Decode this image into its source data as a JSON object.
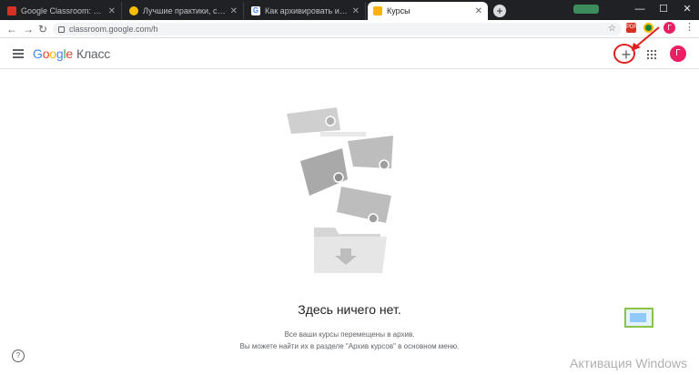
{
  "browser": {
    "tabs": [
      {
        "title": "Google Classroom: функционал",
        "favicon_color": "#d93025",
        "active": false
      },
      {
        "title": "Лучшие практики, советы и ин",
        "favicon_color": "#fbbc04",
        "active": false
      },
      {
        "title": "Как архивировать и удалять кур",
        "favicon_color": "#ffffff",
        "active": false
      },
      {
        "title": "Курсы",
        "favicon_color": "#f4b400",
        "active": true
      }
    ],
    "new_tab_symbol": "+",
    "url": "classroom.google.com/h",
    "extension_label": "PDF",
    "profile_initial": "Г",
    "window_controls": {
      "minimize": "—",
      "maximize": "☐",
      "close": "✕"
    }
  },
  "header": {
    "logo_letters": [
      "G",
      "o",
      "o",
      "g",
      "l",
      "e"
    ],
    "product": "Класс",
    "add_symbol": "+",
    "avatar_initial": "Г"
  },
  "empty_state": {
    "title": "Здесь ничего нет.",
    "line1": "Все ваши курсы перемещены в архив.",
    "line2": "Вы можете найти их в разделе \"Архив курсов\" в основном меню."
  },
  "help_symbol": "?",
  "watermark": "Активация Windows",
  "colors": {
    "highlight": "#e02020",
    "avatar": "#e91e63",
    "accent": "#4285f4"
  }
}
